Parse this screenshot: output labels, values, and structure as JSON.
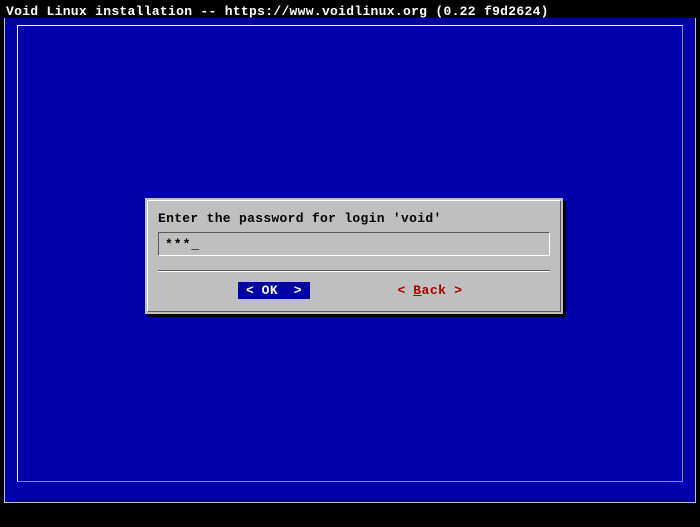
{
  "title": "Void Linux installation -- https://www.voidlinux.org (0.22 f9d2624)",
  "dialog": {
    "prompt": "Enter the password for login 'void'",
    "input_masked": "***",
    "cursor": "_"
  },
  "buttons": {
    "ok": {
      "open": "< ",
      "label": "OK",
      "close": "  >"
    },
    "back": {
      "open": "< ",
      "hotkey": "B",
      "rest": "ack",
      "close": " >"
    }
  }
}
